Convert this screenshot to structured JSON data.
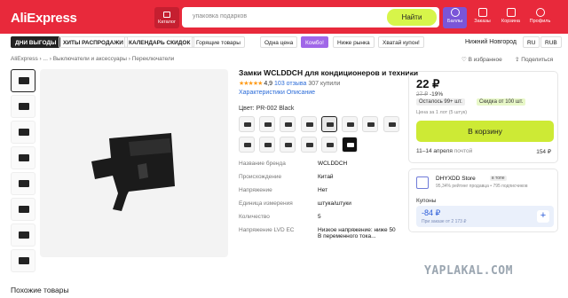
{
  "header": {
    "logo": "AliExpress",
    "catalog_label": "Каталог",
    "search_placeholder": "упаковка подарков",
    "search_button": "Найти",
    "icons": [
      {
        "label": "Баллы",
        "icon": "coin-icon"
      },
      {
        "label": "Заказы",
        "icon": "box-icon"
      },
      {
        "label": "Корзина",
        "icon": "cart-icon"
      },
      {
        "label": "Профиль",
        "icon": "user-icon"
      }
    ]
  },
  "categories": [
    "ДНИ ВЫГОДЫ",
    "ХИТЫ РАСПРОДАЖИ",
    "КАЛЕНДАРЬ СКИДОК",
    "Горящие товары",
    "Одна цена",
    "Комбо!",
    "Ниже рынка",
    "Хватай купон!"
  ],
  "location": {
    "city": "Нижний Новгород",
    "lang": "RU",
    "currency": "RUB"
  },
  "breadcrumbs": {
    "items": [
      "AliExpress",
      "...",
      "Выключатели и аксессуары",
      "Переключатели"
    ],
    "favorite": "В избранное",
    "share": "Поделиться"
  },
  "product": {
    "title": "Замки WCLDDCH для кондиционеров и техники",
    "stars": "★★★★★",
    "rating": "4,9",
    "reviews": "103 отзыва",
    "bought": "307 купили",
    "tab_specs": "Характеристики",
    "tab_desc": "Описание",
    "color_label": "Цвет: PR-002 Black",
    "specs": [
      {
        "key": "Название бренда",
        "value": "WCLDDCH"
      },
      {
        "key": "Происхождение",
        "value": "Китай"
      },
      {
        "key": "Напряжение",
        "value": "Нет"
      },
      {
        "key": "Единица измерения",
        "value": "штука/штуки"
      },
      {
        "key": "Количество",
        "value": "5"
      },
      {
        "key": "Напряжение LVD EC",
        "value": "Низкое напряжение: ниже 50 В переменного тока..."
      }
    ]
  },
  "buybox": {
    "price": "22 ₽",
    "old_price": "27 ₽",
    "discount": "-19%",
    "stock": "Осталось 99+ шт.",
    "bulk_discount": "Скидка от 100 шт.",
    "bulk_note": "Цена за 1 лот (5 штук)",
    "cart_button": "В корзину",
    "delivery_date": "11–14 апреля",
    "delivery_word": "почтой",
    "delivery_price": "154 ₽"
  },
  "store": {
    "name": "DHYXDD Store",
    "badge": "в топе",
    "subtitle": "95,34% рейтинг продавца • 795 подписчиков",
    "coupons_label": "Купоны",
    "coupon_amount": "-84 ₽",
    "coupon_condition": "При заказе от 2 173 ₽"
  },
  "similar_title": "Похожие товары",
  "watermark": "YAPLAKAL.COM"
}
